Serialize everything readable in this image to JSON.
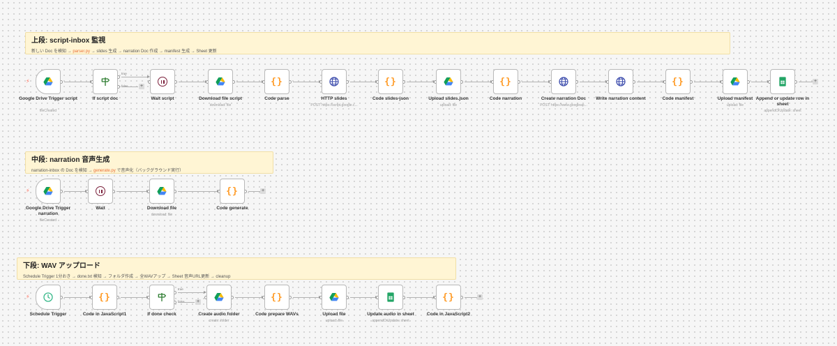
{
  "colors": {
    "accent": "#ff6d5a",
    "note_bg": "#fff5d4",
    "highlight": "#e8703a",
    "code": "#ff9b26",
    "wait": "#7a1f3a",
    "globe": "#3949ab",
    "if": "#2e7d32",
    "sheets": "#23a566",
    "schedule": "#3ab98b"
  },
  "icons": {
    "bolt": "⚡",
    "plus": "+"
  },
  "sections": [
    {
      "note": {
        "title": "上段: script-inbox 監視",
        "desc_parts": [
          {
            "text": "新しい Doc を検知 → "
          },
          {
            "text": "parser.py",
            "hl": true
          },
          {
            "text": " → slides 生成 → narration Doc 作成 → manifest 生成 → Sheet 更新"
          }
        ]
      },
      "nodes": [
        {
          "id": "gdt-script",
          "label": "Google Drive Trigger script",
          "sub": "fileCreated",
          "icon": "google-drive",
          "trigger": true
        },
        {
          "id": "if-script",
          "label": "If script doc",
          "sub": "",
          "icon": "if",
          "branches": [
            "true",
            "false"
          ]
        },
        {
          "id": "wait-script",
          "label": "Wait script",
          "sub": "",
          "icon": "wait"
        },
        {
          "id": "dl-script",
          "label": "Download file script",
          "sub": "download: file",
          "icon": "google-drive"
        },
        {
          "id": "code-parse",
          "label": "Code parse",
          "sub": "",
          "icon": "code"
        },
        {
          "id": "http-slides",
          "label": "HTTP slides",
          "sub": "POST: https://script.google.c...",
          "icon": "globe"
        },
        {
          "id": "code-slides-json",
          "label": "Code slides-json",
          "sub": "",
          "icon": "code"
        },
        {
          "id": "upload-slides",
          "label": "Upload slides.json",
          "sub": "upload: file",
          "icon": "google-drive"
        },
        {
          "id": "code-narration",
          "label": "Code narration",
          "sub": "",
          "icon": "code"
        },
        {
          "id": "create-narration",
          "label": "Create narration Doc",
          "sub": "POST: https://www.googleap...",
          "icon": "globe"
        },
        {
          "id": "write-narration",
          "label": "Write narration content",
          "sub": "",
          "icon": "globe"
        },
        {
          "id": "code-manifest",
          "label": "Code manifest",
          "sub": "",
          "icon": "code"
        },
        {
          "id": "upload-manifest",
          "label": "Upload manifest",
          "sub": "upload: file",
          "icon": "google-drive"
        },
        {
          "id": "append-sheet",
          "label": "Append or update row in sheet",
          "sub": "appendOrUpdate: sheet",
          "icon": "sheets"
        }
      ]
    },
    {
      "note": {
        "title": "中段: narration 音声生成",
        "desc_parts": [
          {
            "text": "narration-inbox の Doc を検知 → "
          },
          {
            "text": "generate.py",
            "hl": true
          },
          {
            "text": " で音声化（バックグラウンド実行）"
          }
        ]
      },
      "nodes": [
        {
          "id": "gdt-narration",
          "label": "Google Drive Trigger narration",
          "sub": "fileCreated",
          "icon": "google-drive",
          "trigger": true
        },
        {
          "id": "wait",
          "label": "Wait",
          "sub": "",
          "icon": "wait"
        },
        {
          "id": "dl-file",
          "label": "Download file",
          "sub": "download: file",
          "icon": "google-drive"
        },
        {
          "id": "code-generate",
          "label": "Code generate",
          "sub": "",
          "icon": "code"
        }
      ]
    },
    {
      "note": {
        "title": "下段: WAV アップロード",
        "desc_parts": [
          {
            "text": "Schedule Trigger 1分おき → done.txt 検知 → フォルダ作成 → 全WAVアップ → Sheet 音声URL更新 → cleanup"
          }
        ]
      },
      "nodes": [
        {
          "id": "schedule",
          "label": "Schedule Trigger",
          "sub": "",
          "icon": "schedule",
          "trigger": true
        },
        {
          "id": "code-js1",
          "label": "Code in JavaScript1",
          "sub": "",
          "icon": "code"
        },
        {
          "id": "if-done",
          "label": "If done check",
          "sub": "",
          "icon": "if",
          "branches": [
            "true",
            "false"
          ]
        },
        {
          "id": "create-folder",
          "label": "Create audio folder",
          "sub": "create: folder",
          "icon": "google-drive"
        },
        {
          "id": "code-wavs",
          "label": "Code prepare WAVs",
          "sub": "",
          "icon": "code"
        },
        {
          "id": "upload-file",
          "label": "Upload file",
          "sub": "upload: file",
          "icon": "google-drive"
        },
        {
          "id": "update-audio",
          "label": "Update audio in sheet",
          "sub": "appendOrUpdate: sheet",
          "icon": "sheets"
        },
        {
          "id": "code-js2",
          "label": "Code in JavaScript2",
          "sub": "",
          "icon": "code"
        }
      ]
    }
  ]
}
